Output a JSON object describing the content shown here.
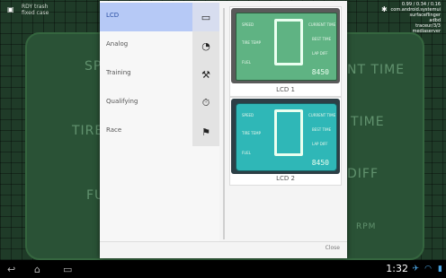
{
  "background": {
    "top_left_lines": [
      "RDY trash",
      "fixed case"
    ],
    "top_right_lines": [
      "0.99 / 0.34 / 0.16",
      "com.android.systemui",
      "surfaceflinger",
      "adbd",
      "traceur/3/3",
      "mediaserver"
    ],
    "dashboard_labels": [
      "SPE",
      "TIRE",
      "FU",
      "NT TIME",
      "TIME",
      "DIFF",
      "RPM"
    ]
  },
  "dialog": {
    "menu_items": [
      {
        "label": "LCD",
        "icon": "lcd-icon",
        "selected": true
      },
      {
        "label": "Analog",
        "icon": "gauge-icon",
        "selected": false
      },
      {
        "label": "Training",
        "icon": "tools-icon",
        "selected": false
      },
      {
        "label": "Qualifying",
        "icon": "stopwatch-icon",
        "selected": false
      },
      {
        "label": "Race",
        "icon": "checkered-flag-icon",
        "selected": false
      }
    ],
    "previews": [
      {
        "caption": "LCD 1"
      },
      {
        "caption": "LCD 2"
      }
    ],
    "lcd_labels": {
      "speed": "SPEED",
      "tire_temp": "TIRE TEMP",
      "fuel": "FUEL",
      "current_time": "CURRENT TIME",
      "best_time": "BEST TIME",
      "lap_diff": "LAP DIFF",
      "odo": "8450"
    },
    "close_label": "Close"
  },
  "statusbar": {
    "clock": "1:32"
  }
}
